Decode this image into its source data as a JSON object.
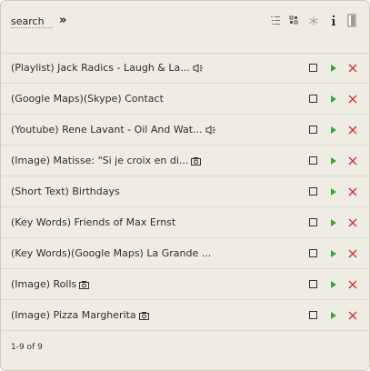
{
  "header": {
    "search_label": "search",
    "go_label": "»",
    "icons": [
      "list-icon",
      "grid-icon",
      "asterisk-icon",
      "info-icon",
      "document-icon"
    ]
  },
  "items": [
    {
      "title": "(Playlist) Jack Radics - Laugh & La...",
      "media": "speaker-icon"
    },
    {
      "title": "(Google Maps)(Skype) Contact",
      "media": ""
    },
    {
      "title": "(Youtube) Rene Lavant - Oil And Wat...",
      "media": "speaker-icon"
    },
    {
      "title": "(Image) Matisse: \"Si je croix en di...",
      "media": "camera-icon"
    },
    {
      "title": "(Short Text) Birthdays",
      "media": ""
    },
    {
      "title": "(Key Words) Friends of Max Ernst",
      "media": ""
    },
    {
      "title": "(Key Words)(Google Maps) La Grande ...",
      "media": ""
    },
    {
      "title": "(Image) Rolls",
      "media": "camera-icon"
    },
    {
      "title": "(Image) Pizza Margherita",
      "media": "camera-icon"
    }
  ],
  "pager": "1-9 of 9",
  "colors": {
    "panel_bg": "#efede3",
    "play_green": "#3aa53a",
    "delete_red": "#cc3333"
  }
}
